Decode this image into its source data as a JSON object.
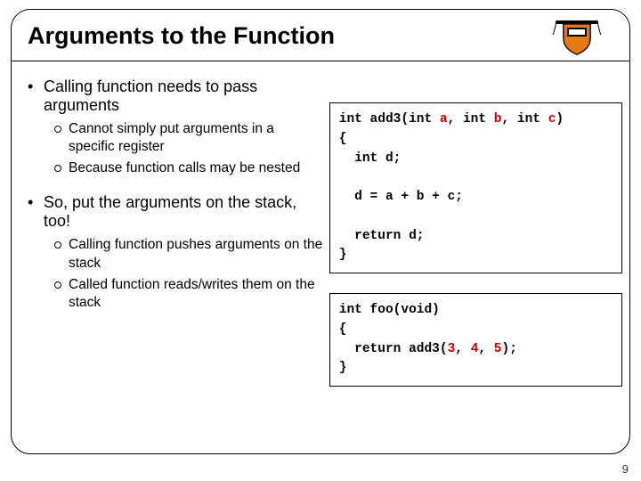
{
  "title": "Arguments to the Function",
  "bullets": {
    "main1": "Calling function needs to pass arguments",
    "sub1a": "Cannot simply put arguments in a specific register",
    "sub1b": "Because function calls may be nested",
    "main2": "So, put the arguments on the stack, too!",
    "sub2a": "Calling function pushes arguments on the stack",
    "sub2b": "Called function reads/writes them on the stack"
  },
  "code": {
    "box1": {
      "l1a": "int add3(int ",
      "l1b": "a",
      "l1c": ", int ",
      "l1d": "b",
      "l1e": ", int ",
      "l1f": "c",
      "l1g": ")",
      "l2": "{",
      "l3": "  int d;",
      "l4": "",
      "l5": "  d = a + b + c;",
      "l6": "",
      "l7": "  return d;",
      "l8": "}"
    },
    "box2": {
      "l1": "int foo(void)",
      "l2": "{",
      "l3a": "  return add3(",
      "l3b": "3",
      "l3c": ", ",
      "l3d": "4",
      "l3e": ", ",
      "l3f": "5",
      "l3g": ");",
      "l4": "}"
    }
  },
  "page": "9"
}
